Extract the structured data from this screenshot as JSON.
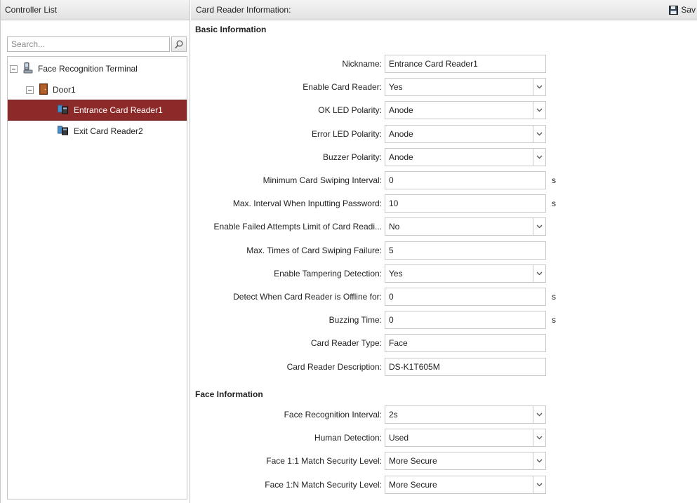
{
  "left_panel": {
    "title": "Controller List",
    "search_placeholder": "Search...",
    "tree": {
      "device": "Face Recognition Terminal",
      "door": "Door1",
      "readers": [
        "Entrance Card Reader1",
        "Exit Card Reader2"
      ]
    }
  },
  "right_panel": {
    "title": "Card Reader Information:",
    "save_label": "Sav",
    "basic_section_title": "Basic Information",
    "face_section_title": "Face Information",
    "basic_fields": [
      {
        "label": "Nickname:",
        "value": "Entrance Card Reader1",
        "type": "text",
        "unit": ""
      },
      {
        "label": "Enable Card Reader:",
        "value": "Yes",
        "type": "select",
        "unit": ""
      },
      {
        "label": "OK LED Polarity:",
        "value": "Anode",
        "type": "select",
        "unit": ""
      },
      {
        "label": "Error LED Polarity:",
        "value": "Anode",
        "type": "select",
        "unit": ""
      },
      {
        "label": "Buzzer Polarity:",
        "value": "Anode",
        "type": "select",
        "unit": ""
      },
      {
        "label": "Minimum Card Swiping Interval:",
        "value": "0",
        "type": "text",
        "unit": "s"
      },
      {
        "label": "Max. Interval When Inputting Password:",
        "value": "10",
        "type": "text",
        "unit": "s"
      },
      {
        "label": "Enable Failed Attempts Limit of Card Readi...",
        "value": "No",
        "type": "select",
        "unit": ""
      },
      {
        "label": "Max. Times of Card Swiping Failure:",
        "value": "5",
        "type": "text",
        "unit": ""
      },
      {
        "label": "Enable Tampering Detection:",
        "value": "Yes",
        "type": "select",
        "unit": ""
      },
      {
        "label": "Detect When Card Reader is Offline for:",
        "value": "0",
        "type": "text",
        "unit": "s"
      },
      {
        "label": "Buzzing Time:",
        "value": "0",
        "type": "text",
        "unit": "s"
      },
      {
        "label": "Card Reader Type:",
        "value": "Face",
        "type": "readonly",
        "unit": ""
      },
      {
        "label": "Card Reader Description:",
        "value": "DS-K1T605M",
        "type": "readonly",
        "unit": ""
      }
    ],
    "face_fields": [
      {
        "label": "Face Recognition Interval:",
        "value": "2s",
        "type": "select",
        "unit": ""
      },
      {
        "label": "Human Detection:",
        "value": "Used",
        "type": "select",
        "unit": ""
      },
      {
        "label": "Face 1:1 Match Security Level:",
        "value": "More Secure",
        "type": "select",
        "unit": ""
      },
      {
        "label": "Face 1:N Match Security Level:",
        "value": "More Secure",
        "type": "select",
        "unit": ""
      }
    ]
  },
  "colors": {
    "selected_row": "#8c2a2a",
    "header_gradient_top": "#f4f4f4",
    "header_gradient_bottom": "#e2e2e2",
    "border": "#c7c7c7"
  }
}
